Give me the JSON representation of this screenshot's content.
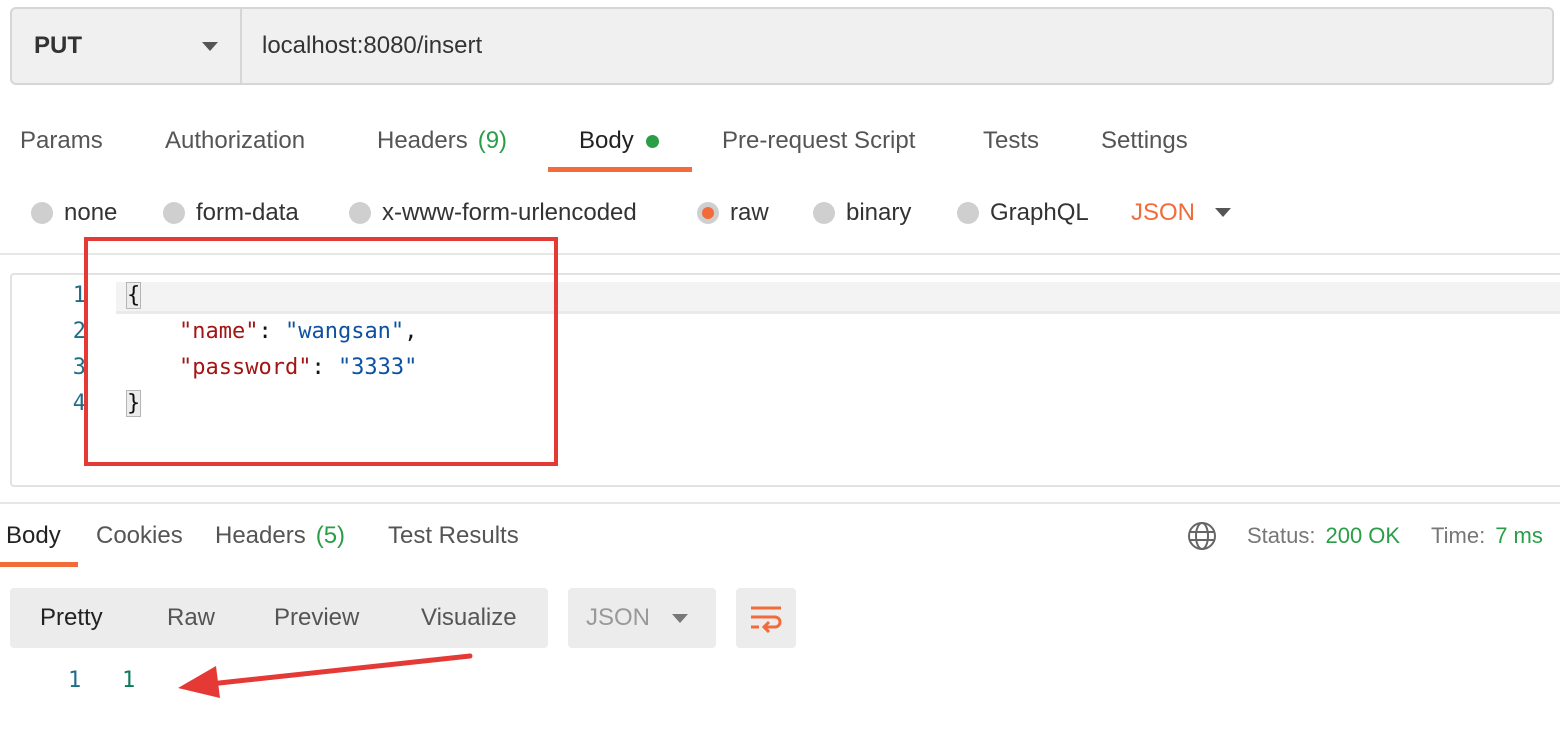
{
  "request": {
    "method": "PUT",
    "url": "localhost:8080/insert"
  },
  "request_tabs": {
    "params": "Params",
    "authorization": "Authorization",
    "headers": "Headers",
    "headers_count": "(9)",
    "body": "Body",
    "pre_request": "Pre-request Script",
    "tests": "Tests",
    "settings": "Settings"
  },
  "body_types": {
    "none": "none",
    "form_data": "form-data",
    "urlencoded": "x-www-form-urlencoded",
    "raw": "raw",
    "binary": "binary",
    "graphql": "GraphQL",
    "selected": "raw",
    "language": "JSON"
  },
  "editor": {
    "line_numbers": [
      "1",
      "2",
      "3",
      "4"
    ],
    "open_brace": "{",
    "close_brace": "}",
    "fields": [
      {
        "key": "\"name\"",
        "value": "\"wangsan\"",
        "trailing": ","
      },
      {
        "key": "\"password\"",
        "value": "\"3333\"",
        "trailing": ""
      }
    ]
  },
  "response_tabs": {
    "body": "Body",
    "cookies": "Cookies",
    "headers": "Headers",
    "headers_count": "(5)",
    "test_results": "Test Results"
  },
  "response_meta": {
    "status_label": "Status:",
    "status_value": "200 OK",
    "time_label": "Time:",
    "time_value": "7 ms"
  },
  "response_view": {
    "pretty": "Pretty",
    "raw": "Raw",
    "preview": "Preview",
    "visualize": "Visualize",
    "format": "JSON"
  },
  "response_body": {
    "line_number": "1",
    "value": "1"
  },
  "colors": {
    "accent": "#f26b3a",
    "success": "#2a9d47",
    "annotation": "#e53935"
  },
  "icons": [
    "dropdown-caret-icon",
    "globe-icon",
    "wrap-lines-icon",
    "arrow-annotation"
  ]
}
